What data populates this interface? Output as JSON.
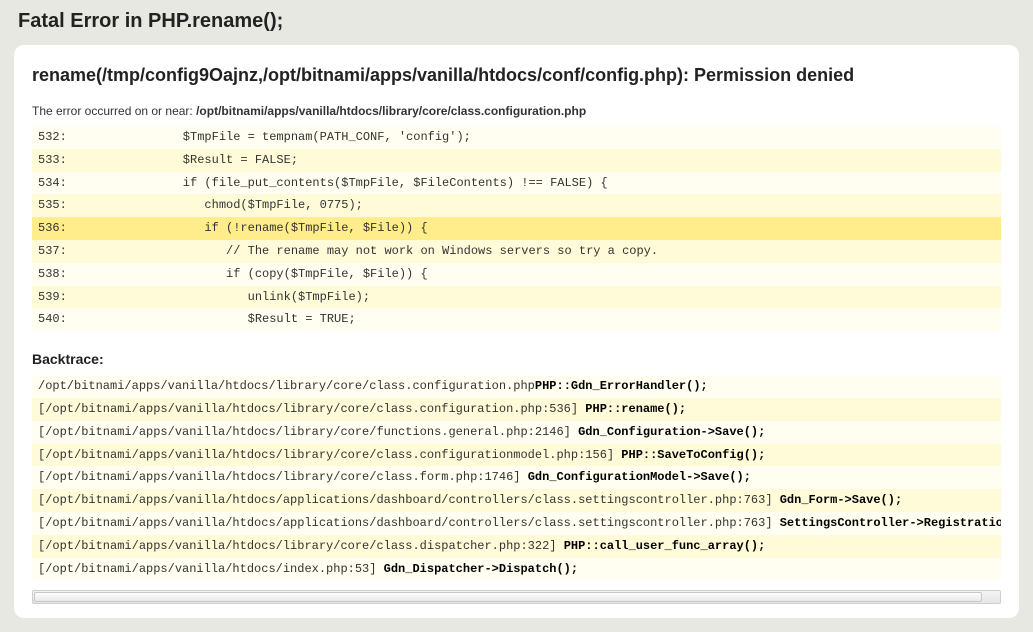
{
  "page_title": "Fatal Error in PHP.rename();",
  "error_message": "rename(/tmp/config9Oajnz,/opt/bitnami/apps/vanilla/htdocs/conf/config.php): Permission denied",
  "occurred_label": "The error occurred on or near: ",
  "occurred_path": "/opt/bitnami/apps/vanilla/htdocs/library/core/class.configuration.php",
  "highlight_line": "536",
  "code_lines": [
    {
      "no": "532:",
      "code": "         $TmpFile = tempnam(PATH_CONF, 'config');"
    },
    {
      "no": "533:",
      "code": "         $Result = FALSE;"
    },
    {
      "no": "534:",
      "code": "         if (file_put_contents($TmpFile, $FileContents) !== FALSE) {"
    },
    {
      "no": "535:",
      "code": "            chmod($TmpFile, 0775);"
    },
    {
      "no": "536:",
      "code": "            if (!rename($TmpFile, $File)) {"
    },
    {
      "no": "537:",
      "code": "               // The rename may not work on Windows servers so try a copy."
    },
    {
      "no": "538:",
      "code": "               if (copy($TmpFile, $File)) {"
    },
    {
      "no": "539:",
      "code": "                  unlink($TmpFile);"
    },
    {
      "no": "540:",
      "code": "                  $Result = TRUE;"
    }
  ],
  "backtrace_heading": "Backtrace:",
  "backtrace": [
    {
      "loc": "/opt/bitnami/apps/vanilla/htdocs/library/core/class.configuration.php",
      "call": "PHP::Gdn_ErrorHandler();"
    },
    {
      "loc": "[/opt/bitnami/apps/vanilla/htdocs/library/core/class.configuration.php:536] ",
      "call": "PHP::rename();"
    },
    {
      "loc": "[/opt/bitnami/apps/vanilla/htdocs/library/core/functions.general.php:2146] ",
      "call": "Gdn_Configuration->Save();"
    },
    {
      "loc": "[/opt/bitnami/apps/vanilla/htdocs/library/core/class.configurationmodel.php:156] ",
      "call": "PHP::SaveToConfig();"
    },
    {
      "loc": "[/opt/bitnami/apps/vanilla/htdocs/library/core/class.form.php:1746] ",
      "call": "Gdn_ConfigurationModel->Save();"
    },
    {
      "loc": "[/opt/bitnami/apps/vanilla/htdocs/applications/dashboard/controllers/class.settingscontroller.php:763] ",
      "call": "Gdn_Form->Save();"
    },
    {
      "loc": "[/opt/bitnami/apps/vanilla/htdocs/applications/dashboard/controllers/class.settingscontroller.php:763] ",
      "call": "SettingsController->Registratio"
    },
    {
      "loc": "[/opt/bitnami/apps/vanilla/htdocs/library/core/class.dispatcher.php:322] ",
      "call": "PHP::call_user_func_array();"
    },
    {
      "loc": "[/opt/bitnami/apps/vanilla/htdocs/index.php:53] ",
      "call": "Gdn_Dispatcher->Dispatch();"
    }
  ]
}
